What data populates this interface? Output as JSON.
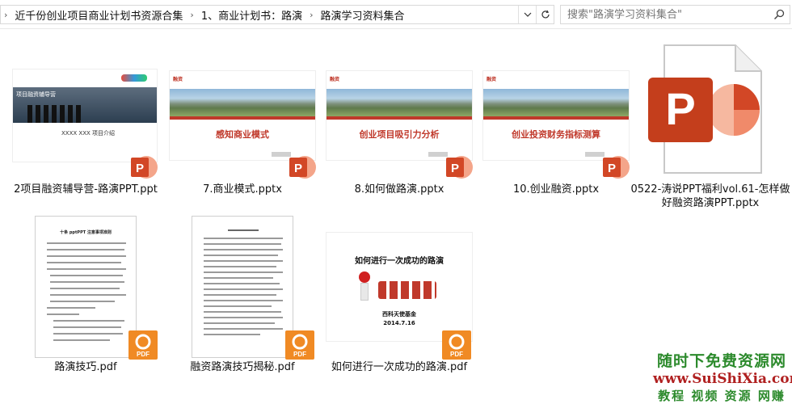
{
  "address_bar": {
    "breadcrumbs": [
      "近千份创业项目商业计划书资源合集",
      "1、商业计划书：路演",
      "路演学习资料集合"
    ],
    "dropdown_icon": "chevron-down-icon",
    "refresh_icon": "refresh-icon"
  },
  "search": {
    "placeholder": "搜索\"路演学习资料集合\""
  },
  "files": [
    {
      "name": "2项目融资辅导营-路演PPT.ppt",
      "type": "ppt",
      "slide_text": "项目融资辅导营",
      "slide_sub": "XXXX XXX 项目介绍"
    },
    {
      "name": "7.商业模式.pptx",
      "type": "pptx",
      "slide_tag": "融资",
      "slide_title": "感知商业模式"
    },
    {
      "name": "8.如何做路演.pptx",
      "type": "pptx",
      "slide_tag": "融资",
      "slide_title": "创业项目吸引力分析"
    },
    {
      "name": "10.创业融资.pptx",
      "type": "pptx",
      "slide_tag": "融资",
      "slide_title": "创业投资财务指标测算"
    },
    {
      "name": "0522-涛说PPT福利vol.61-怎样做好融资路演PPT.pptx",
      "type": "pptx"
    },
    {
      "name": "路演技巧.pdf",
      "type": "pdf",
      "page_title": "十条 pptPPT 注意事项准则"
    },
    {
      "name": "融资路演技巧揭秘.pdf",
      "type": "pdf"
    },
    {
      "name": "如何进行一次成功的路演.pdf",
      "type": "pdf",
      "cover_title": "如何进行一次成功的路演",
      "cover_org": "西科天使基金",
      "cover_date": "2014.7.16"
    }
  ],
  "watermark": {
    "line1": "随时下免费资源网",
    "line2": "www.SuiShiXia.com",
    "line3": "教程 视频 资源 网赚"
  },
  "colors": {
    "ppt_badge": "#d24726",
    "pdf_badge": "#f08a24",
    "accent_red": "#c0392b"
  }
}
